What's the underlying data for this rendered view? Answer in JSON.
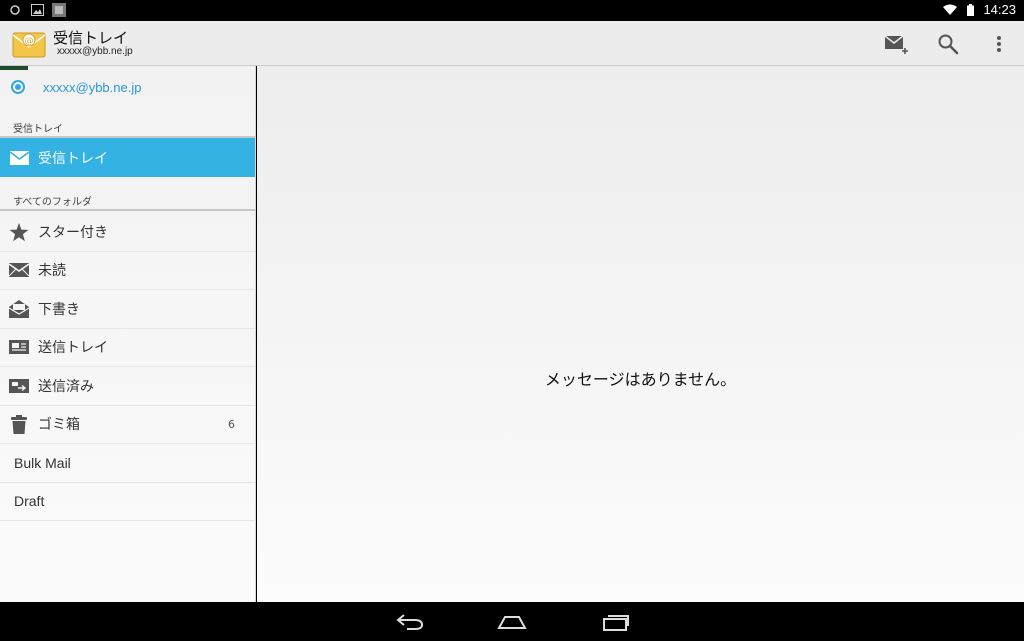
{
  "status_bar": {
    "time": "14:23"
  },
  "action_bar": {
    "title": "受信トレイ",
    "account": "xxxxx@ybb.ne.jp"
  },
  "drawer": {
    "account": "xxxxx@ybb.ne.jp",
    "section_inbox": "受信トレイ",
    "inbox_label": "受信トレイ",
    "section_all_folders": "すべてのフォルダ",
    "folders": [
      {
        "label": "スター付き",
        "icon": "star-icon"
      },
      {
        "label": "未読",
        "icon": "unread-mail-icon"
      },
      {
        "label": "下書き",
        "icon": "draft-icon"
      },
      {
        "label": "送信トレイ",
        "icon": "outbox-icon"
      },
      {
        "label": "送信済み",
        "icon": "sent-icon"
      },
      {
        "label": "ゴミ箱",
        "icon": "trash-icon",
        "count": "6"
      },
      {
        "label": "Bulk Mail"
      },
      {
        "label": "Draft"
      }
    ]
  },
  "content": {
    "empty_message": "メッセージはありません。"
  },
  "colors": {
    "accent": "#34b2e4",
    "account_text": "#2a9ad4"
  }
}
